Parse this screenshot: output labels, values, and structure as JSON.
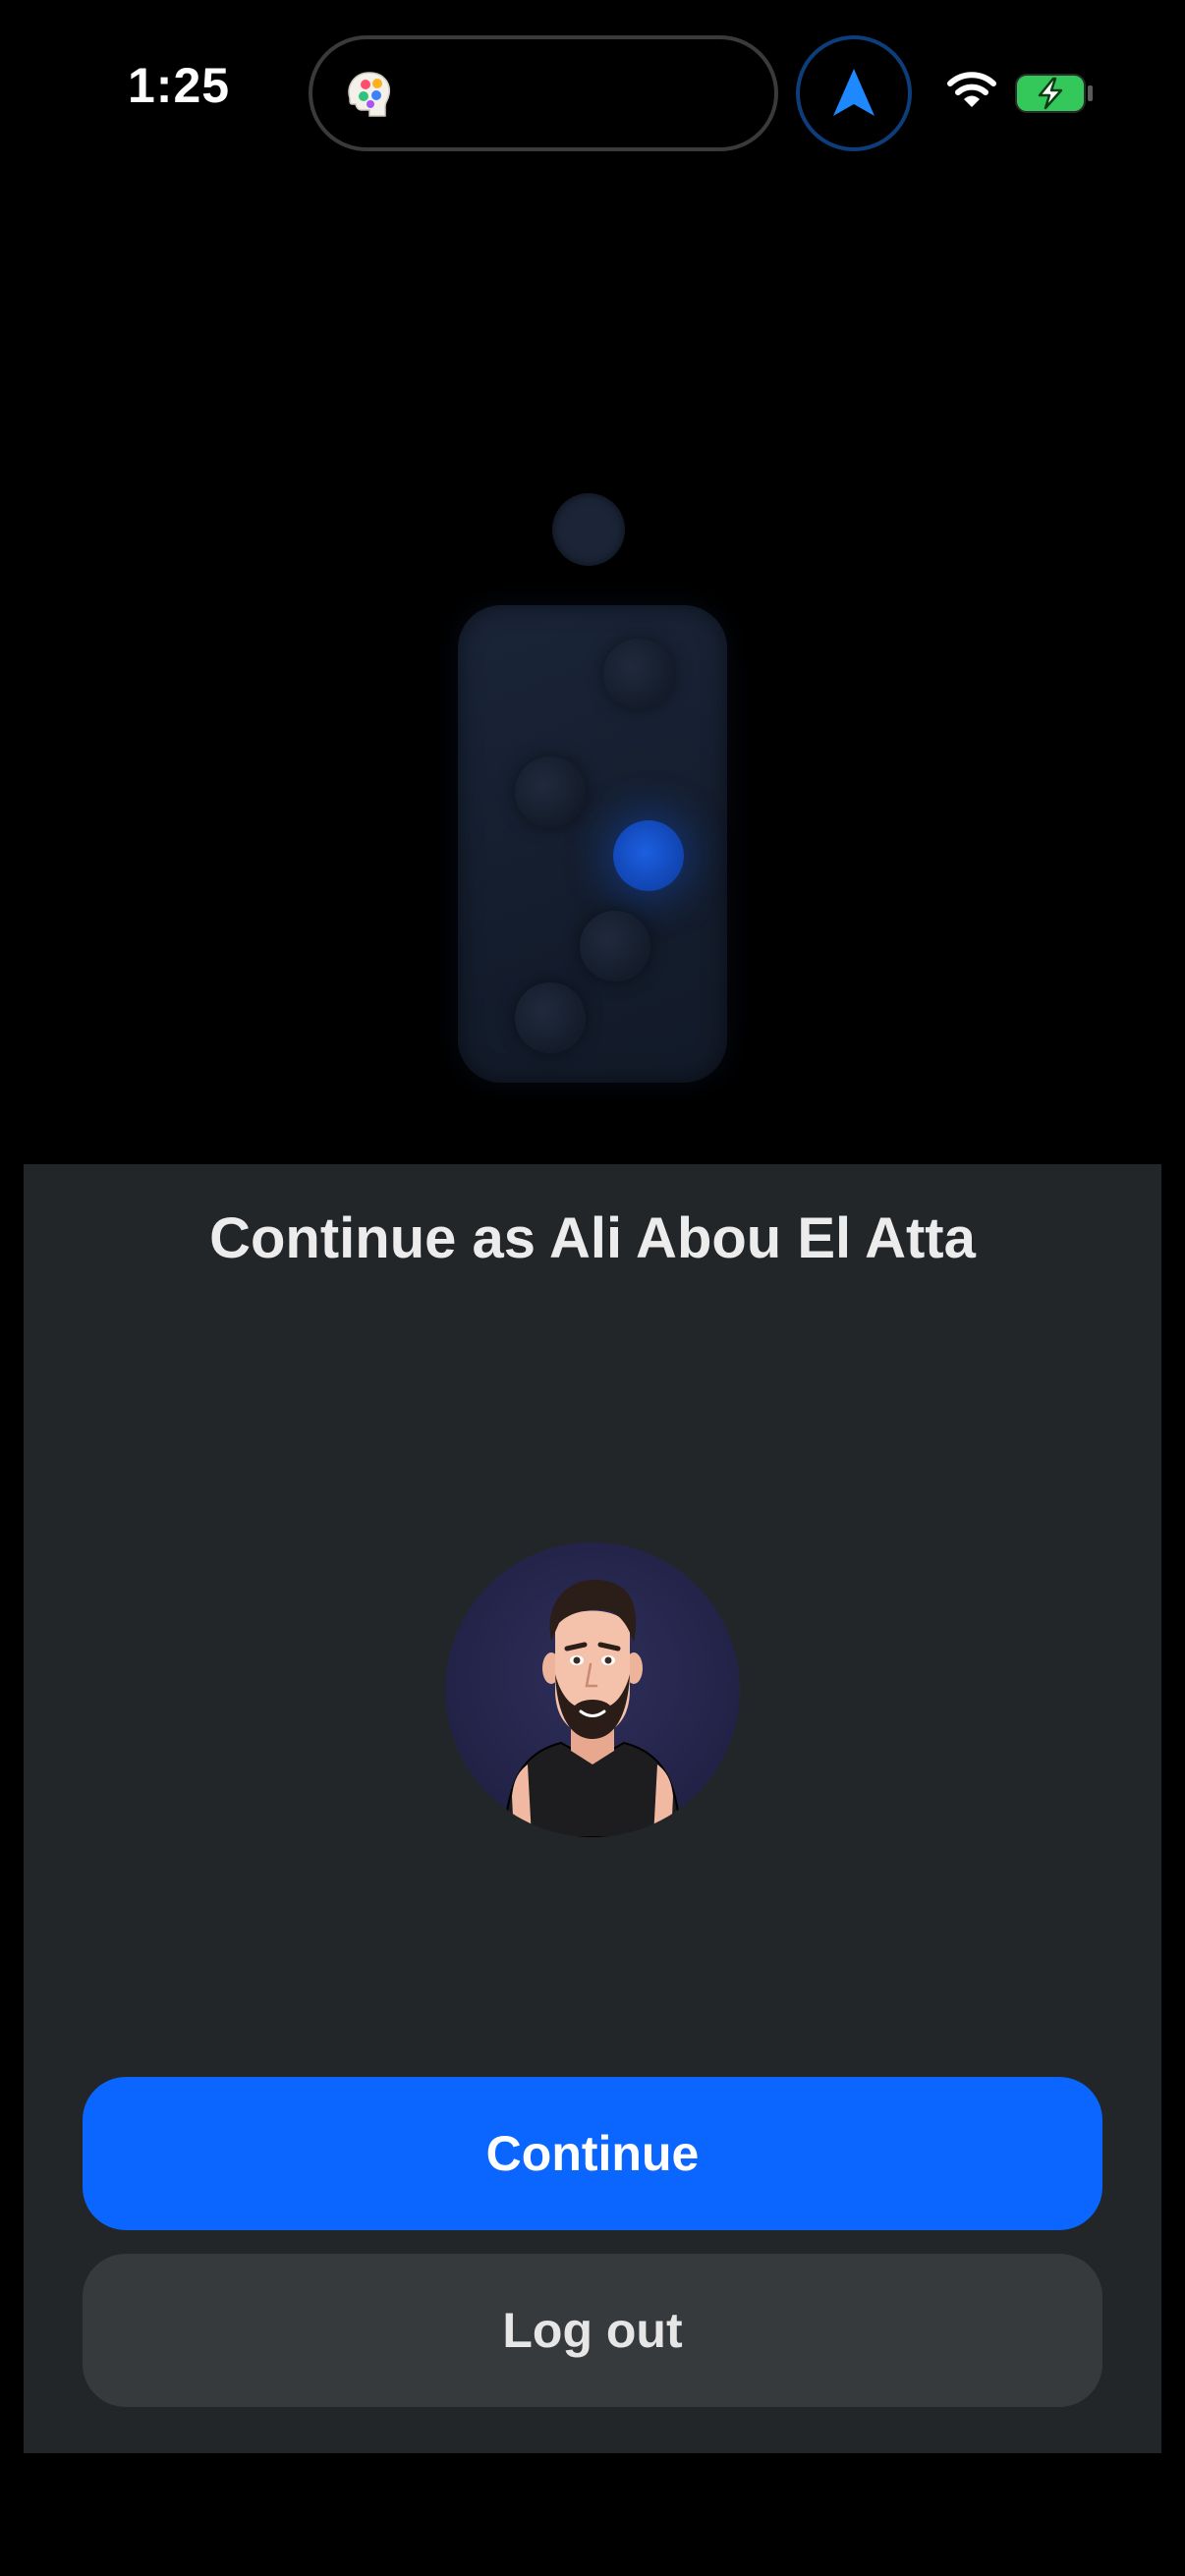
{
  "status_bar": {
    "time": "1:25",
    "island_app_icon": "brain-palette-icon",
    "nav_icon": "location-arrow-icon",
    "wifi_icon": "wifi-icon",
    "battery_icon": "battery-charging-icon",
    "colors": {
      "nav_accent": "#1e88ff",
      "battery_fill": "#34c759"
    }
  },
  "illustration": {
    "name": "lock-illustration",
    "active_color": "#1458d6"
  },
  "sheet": {
    "title": "Continue as Ali Abou El Atta",
    "avatar": "user-avatar",
    "continue_label": "Continue",
    "logout_label": "Log out",
    "colors": {
      "sheet_bg": "#232628",
      "primary": "#0a66ff",
      "secondary": "#373a3c"
    }
  }
}
